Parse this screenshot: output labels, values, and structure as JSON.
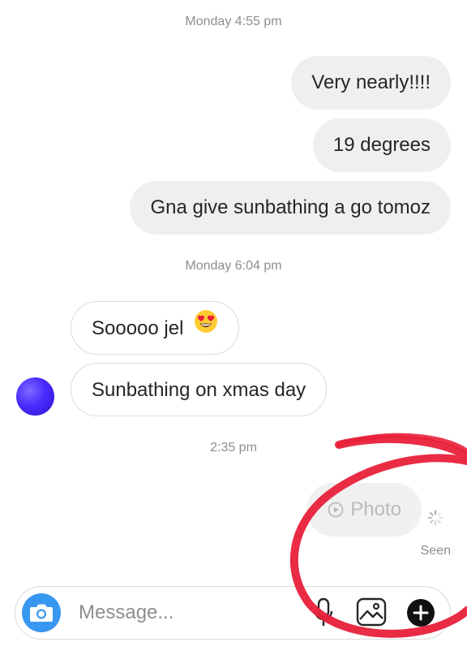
{
  "conversation": {
    "groups": [
      {
        "timestamp": "Monday 4:55 pm"
      },
      {
        "timestamp": "Monday 6:04 pm"
      },
      {
        "timestamp": "2:35 pm"
      }
    ],
    "messages": [
      {
        "text": "Very nearly!!!!",
        "direction": "outgoing"
      },
      {
        "text": "19 degrees",
        "direction": "outgoing"
      },
      {
        "text": "Gna give sunbathing a go tomoz",
        "direction": "outgoing"
      },
      {
        "text": "Sooooo jel",
        "emoji": "heart-eyes-emoji",
        "direction": "incoming"
      },
      {
        "text": "Sunbathing on xmas day",
        "direction": "incoming"
      },
      {
        "text": "Photo",
        "icon": "play-circle-icon",
        "direction": "outgoing",
        "state": "sending"
      }
    ],
    "status": "Seen"
  },
  "composer": {
    "placeholder": "Message...",
    "value": "",
    "icons": [
      "camera-icon",
      "microphone-icon",
      "gallery-icon",
      "plus-icon"
    ]
  },
  "colors": {
    "accent": "#3897f0",
    "outgoing_bubble": "#efefef",
    "incoming_border": "#dbdbdb",
    "meta_text": "#8e8e8e",
    "annotation_marker": "#e8203a"
  }
}
